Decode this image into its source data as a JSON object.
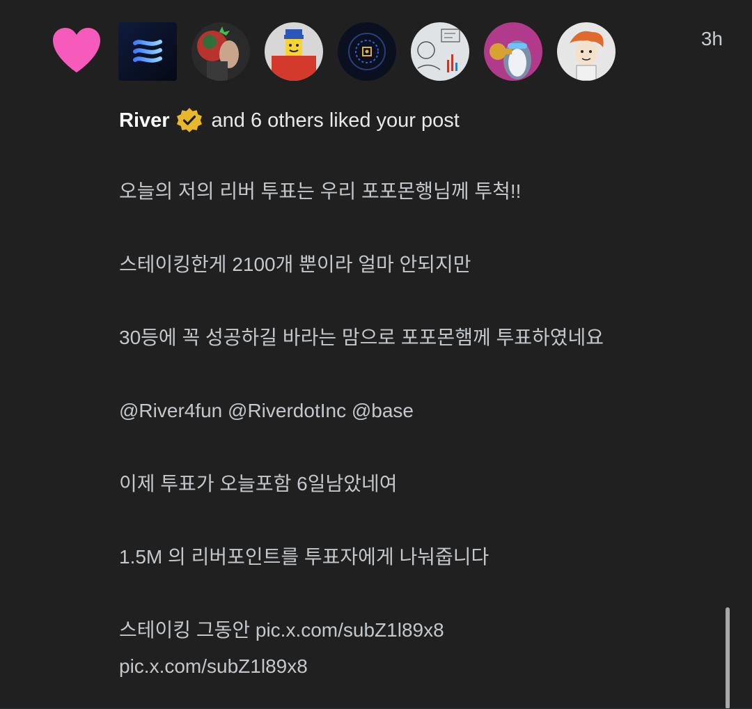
{
  "notification": {
    "type_icon": "heart-icon",
    "avatars": [
      {
        "icon": "river-logo-avatar"
      },
      {
        "icon": "user-avatar-profile"
      },
      {
        "icon": "user-avatar-roblox"
      },
      {
        "icon": "user-avatar-dark-logo"
      },
      {
        "icon": "user-avatar-sketch"
      },
      {
        "icon": "user-avatar-penguin"
      },
      {
        "icon": "user-avatar-cartoon"
      }
    ],
    "timestamp": "3h",
    "liked_by_name": "River",
    "verified_icon": "verified-badge-icon",
    "liked_text": "and 6 others liked your post",
    "post_lines": [
      "오늘의 저의 리버 투표는 우리 포포몬행님께 투척!!",
      "스테이킹한게 2100개 뿐이라 얼마 안되지만",
      "30등에 꼭 성공하길 바라는 맘으로 포포몬햄께 투표하였네요",
      "@River4fun @RiverdotInc @base",
      "이제 투표가 오늘포함 6일남았네여",
      "1.5M 의 리버포인트를 투표자에게 나눠줍니다",
      "스테이킹 그동안 pic.x.com/subZ1l89x8",
      "pic.x.com/subZ1l89x8"
    ]
  },
  "colors": {
    "background": "#202020",
    "heart": "#f65aba",
    "verified": "#e8b829",
    "text_primary": "#ffffff",
    "text_secondary": "#c4c8cc"
  }
}
